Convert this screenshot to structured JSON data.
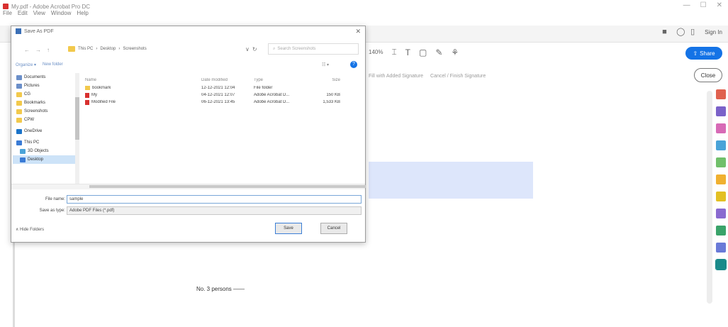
{
  "app": {
    "title": "My.pdf - Adobe Acrobat Pro DC",
    "menu": [
      "File",
      "Edit",
      "View",
      "Window",
      "Help"
    ],
    "window_controls": [
      "—",
      "☐",
      "✕"
    ],
    "sign_in": "Sign In",
    "zoom": "140%",
    "share_label": "Share",
    "close_label": "Close",
    "fill_hints": [
      "Fill with Added Signature",
      "Cancel / Finish Signature"
    ]
  },
  "document": {
    "text": "No. 3 persons ——"
  },
  "dialog": {
    "title": "Save As PDF",
    "breadcrumb": [
      "This PC",
      "Desktop",
      "Screenshots"
    ],
    "search_placeholder": "Search Screenshots",
    "organize_label": "Organize ▾",
    "new_folder_label": "New folder",
    "view_label": "☷ ▾",
    "help_label": "?",
    "nav_items": [
      "Documents",
      "Pictures",
      "CG",
      "Bookmarks",
      "Screenshots",
      "CPW",
      "OneDrive",
      "This PC",
      "3D Objects",
      "Desktop"
    ],
    "columns": [
      "Name",
      "Date modified",
      "Type",
      "Size"
    ],
    "files": [
      {
        "name": "bookmark",
        "date": "12-12-2021 12:04",
        "type": "File folder",
        "size": ""
      },
      {
        "name": "My",
        "date": "04-12-2021 12:07",
        "type": "Adobe Acrobat D...",
        "size": "150 KB"
      },
      {
        "name": "Modified File",
        "date": "06-12-2021 13:45",
        "type": "Adobe Acrobat D...",
        "size": "1,533 KB"
      }
    ],
    "file_name_label": "File name:",
    "file_name_value": "sample",
    "save_type_label": "Save as type:",
    "save_type_value": "Adobe PDF Files (*.pdf)",
    "hide_folders_label": "∧ Hide Folders",
    "save_label": "Save",
    "cancel_label": "Cancel"
  },
  "colors": {
    "accent": "#1473e6",
    "highlight": "#dde6fb",
    "folder": "#f2c94c",
    "pdf": "#d8302f"
  }
}
